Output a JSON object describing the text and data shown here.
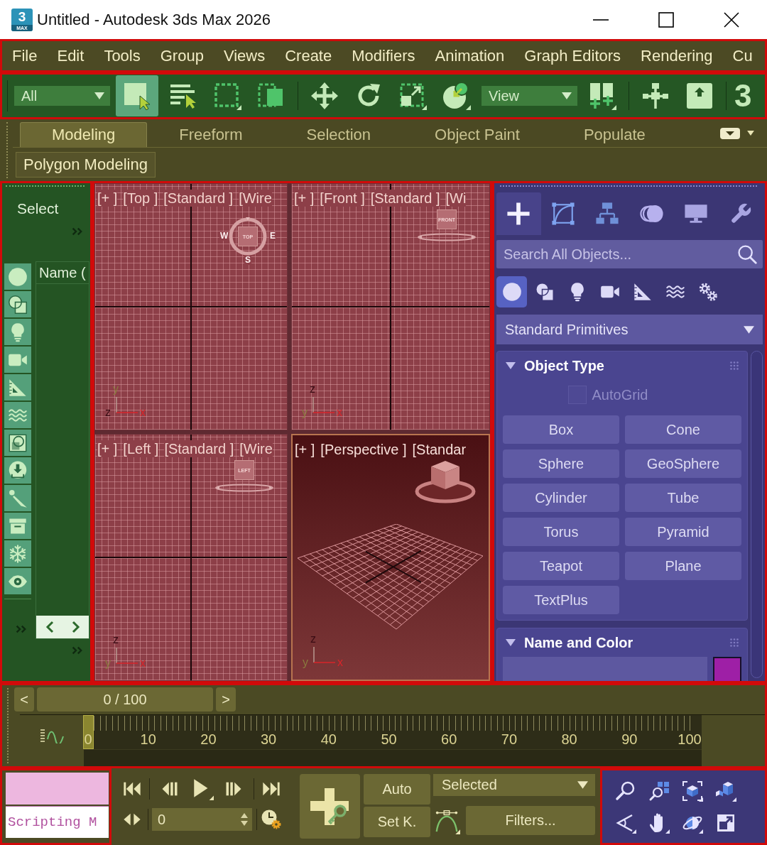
{
  "window": {
    "title": "Untitled - Autodesk 3ds Max 2026",
    "logo": {
      "digit": "3",
      "caption": "MAX"
    }
  },
  "menu": [
    "File",
    "Edit",
    "Tools",
    "Group",
    "Views",
    "Create",
    "Modifiers",
    "Animation",
    "Graph Editors",
    "Rendering",
    "Cu"
  ],
  "toolbar": {
    "groups": [
      [
        {
          "kind": "dropdown",
          "label": "All"
        },
        {
          "kind": "select",
          "selected": true
        },
        {
          "kind": "list",
          "selected": false
        },
        {
          "kind": "region",
          "selected": false
        },
        {
          "kind": "crossing",
          "selected": false
        }
      ],
      [
        {
          "kind": "move",
          "selected": false
        },
        {
          "kind": "rotate",
          "selected": false
        },
        {
          "kind": "scale",
          "selected": false
        },
        {
          "kind": "placement",
          "selected": false
        },
        {
          "kind": "dropdown",
          "label": "View"
        },
        {
          "kind": "pivot",
          "selected": false
        }
      ],
      [
        {
          "kind": "manipulate",
          "selected": false
        },
        {
          "kind": "override",
          "selected": false
        }
      ],
      [
        {
          "kind": "snap",
          "label": "3"
        }
      ]
    ]
  },
  "ribbon": {
    "tabs": [
      {
        "label": "Modeling",
        "selected": true
      },
      {
        "label": "Freeform",
        "selected": false
      },
      {
        "label": "Selection",
        "selected": false
      },
      {
        "label": "Object Paint",
        "selected": false
      },
      {
        "label": "Populate",
        "selected": false
      }
    ],
    "panels": [
      "Polygon Modeling"
    ]
  },
  "scene_explorer": {
    "menu": "Select",
    "column_header": "Name (",
    "filters": [
      {
        "kind": "geometry"
      },
      {
        "kind": "shapes"
      },
      {
        "kind": "lights"
      },
      {
        "kind": "cameras"
      },
      {
        "kind": "helpers"
      },
      {
        "kind": "warps"
      },
      {
        "kind": "groups"
      },
      {
        "kind": "xrefs"
      },
      {
        "kind": "bones"
      },
      {
        "kind": "containers"
      },
      {
        "kind": "frozen"
      },
      {
        "kind": "hidden"
      }
    ]
  },
  "viewports": [
    {
      "kind": "ortho",
      "active": false,
      "labels": [
        "[+ ]",
        "[Top ]",
        "[Standard ]",
        "[Wire"
      ],
      "cube": "TOP",
      "compass": [
        "W",
        "E",
        "S"
      ],
      "axes": [
        {
          "label": "y",
          "color": "#8a7a3e"
        },
        {
          "label": "z",
          "color": "#3a0c14"
        },
        {
          "label": "x",
          "color": "#d8252a"
        }
      ]
    },
    {
      "kind": "ortho",
      "active": false,
      "labels": [
        "[+ ]",
        "[Front ]",
        "[Standard ]",
        "[Wi"
      ],
      "cube": "FRONT",
      "axes": [
        {
          "label": "z",
          "color": "#3a0c14"
        },
        {
          "label": "y",
          "color": "#8a7a3e"
        },
        {
          "label": "x",
          "color": "#d8252a"
        }
      ]
    },
    {
      "kind": "ortho",
      "active": false,
      "labels": [
        "[+ ]",
        "[Left ]",
        "[Standard ]",
        "[Wire"
      ],
      "cube": "LEFT",
      "axes": [
        {
          "label": "z",
          "color": "#3a0c14"
        },
        {
          "label": "y",
          "color": "#8a7a3e"
        },
        {
          "label": "x",
          "color": "#d8252a"
        }
      ]
    },
    {
      "kind": "perspective",
      "active": true,
      "labels": [
        "[+ ]",
        "[Perspective ]",
        "[Standar"
      ],
      "axes": [
        {
          "label": "z",
          "color": "#3a0c14"
        },
        {
          "label": "y",
          "color": "#8a7a3e"
        },
        {
          "label": "x",
          "color": "#d8252a"
        }
      ]
    }
  ],
  "command_panel": {
    "tabs": [
      {
        "kind": "create",
        "selected": true
      },
      {
        "kind": "modify",
        "selected": false
      },
      {
        "kind": "hierarchy",
        "selected": false
      },
      {
        "kind": "motion",
        "selected": false
      },
      {
        "kind": "display",
        "selected": false
      },
      {
        "kind": "utilities",
        "selected": false
      }
    ],
    "search": {
      "placeholder": "Search All Objects..."
    },
    "categories": [
      {
        "kind": "geometry",
        "selected": true
      },
      {
        "kind": "shapes",
        "selected": false
      },
      {
        "kind": "lights",
        "selected": false
      },
      {
        "kind": "cameras",
        "selected": false
      },
      {
        "kind": "helpers",
        "selected": false
      },
      {
        "kind": "warps",
        "selected": false
      },
      {
        "kind": "systems",
        "selected": false
      }
    ],
    "object_class": "Standard Primitives",
    "rollouts": [
      {
        "title": "Object Type",
        "expanded": true,
        "autogrid": {
          "label": "AutoGrid",
          "checked": false,
          "disabled": true
        },
        "buttons": [
          "Box",
          "Cone",
          "Sphere",
          "GeoSphere",
          "Cylinder",
          "Tube",
          "Torus",
          "Pyramid",
          "Teapot",
          "Plane",
          "TextPlus"
        ]
      },
      {
        "title": "Name and Color",
        "expanded": true,
        "color": "#9e1fa6"
      }
    ]
  },
  "timeline": {
    "time_slider": {
      "previous": "<",
      "label": "0 / 100",
      "next": ">"
    },
    "trackbar": {
      "labels": [
        "0",
        "10",
        "20",
        "30",
        "40",
        "50",
        "60",
        "70",
        "80",
        "90",
        "100"
      ],
      "level": 0
    }
  },
  "status": {
    "script": {
      "value": "Scripting M"
    },
    "frame": {
      "value": "0"
    },
    "auto_key": {
      "label": "Auto",
      "on": false
    },
    "set_key": {
      "label": "Set K."
    },
    "key_filter": {
      "value": "Selected"
    },
    "filters": {
      "label": "Filters..."
    }
  }
}
